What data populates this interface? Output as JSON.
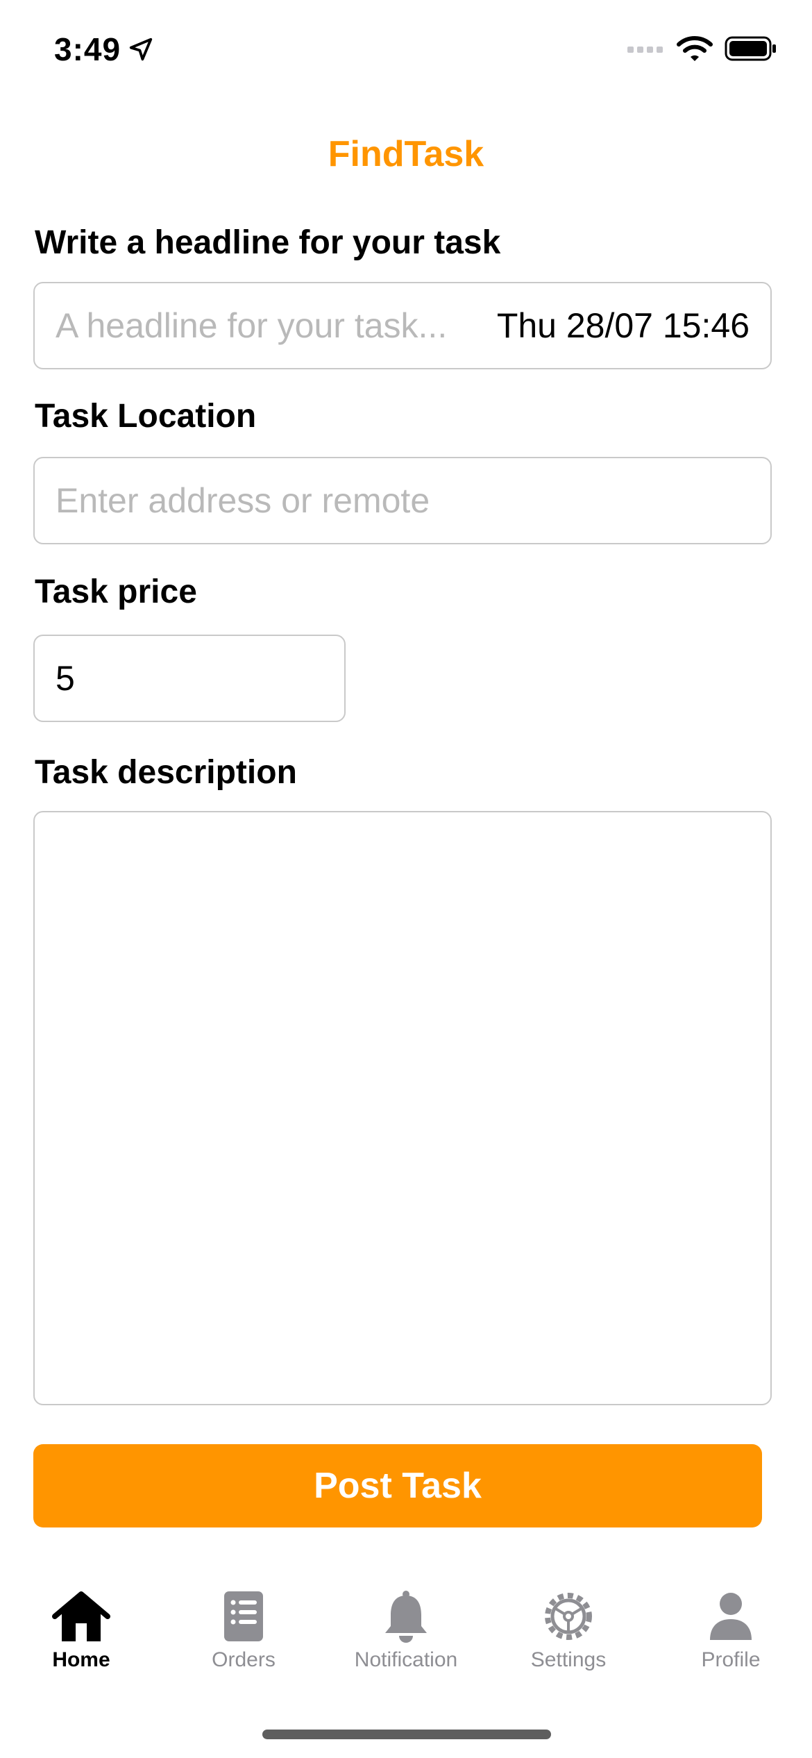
{
  "status_bar": {
    "time": "3:49"
  },
  "app": {
    "title": "FindTask"
  },
  "form": {
    "headline": {
      "label": "Write a headline for your task",
      "placeholder": "A headline for your task...",
      "date": "Thu 28/07 15:46"
    },
    "location": {
      "label": "Task Location",
      "placeholder": "Enter address or remote"
    },
    "price": {
      "label": "Task price",
      "value": "5"
    },
    "description": {
      "label": "Task description",
      "value": ""
    },
    "submit_label": "Post Task"
  },
  "tab_bar": {
    "tabs": [
      {
        "label": "Home",
        "icon": "home-icon",
        "active": true
      },
      {
        "label": "Orders",
        "icon": "orders-icon",
        "active": false
      },
      {
        "label": "Notification",
        "icon": "bell-icon",
        "active": false
      },
      {
        "label": "Settings",
        "icon": "gear-icon",
        "active": false
      },
      {
        "label": "Profile",
        "icon": "person-icon",
        "active": false
      }
    ]
  },
  "colors": {
    "accent": "#FF9500",
    "tab_inactive": "#8E8E93",
    "placeholder": "#B9B9B9",
    "border": "#C9C9C9"
  }
}
